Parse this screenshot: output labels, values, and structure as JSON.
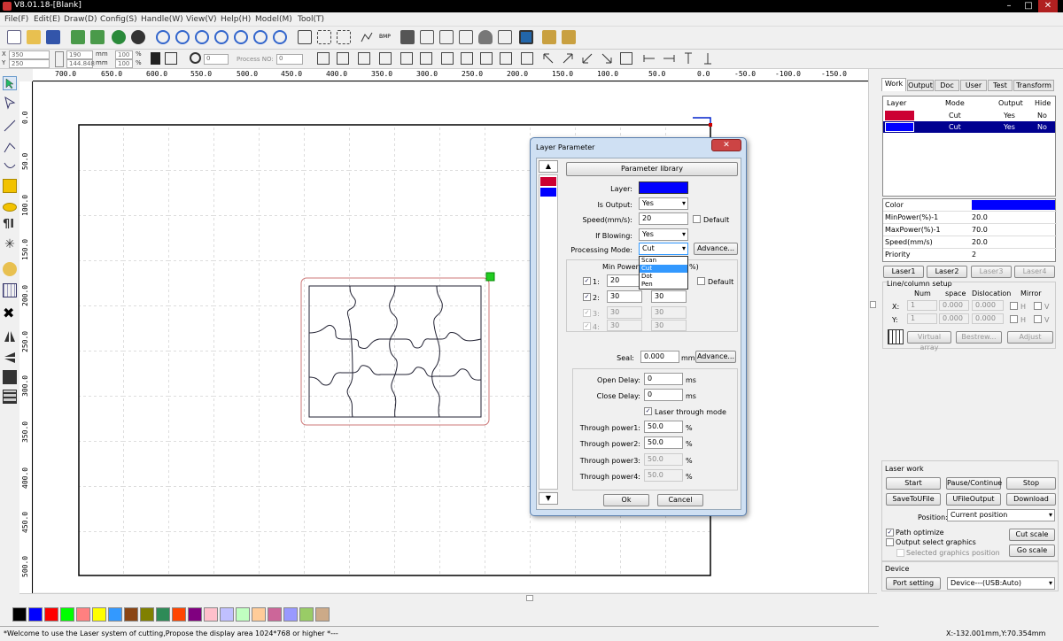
{
  "window": {
    "title": "V8.01.18-[Blank]",
    "min_icon": "minimize-icon",
    "max_icon": "maximize-icon",
    "close_icon": "close-icon"
  },
  "menu": [
    "File(F)",
    "Edit(E)",
    "Draw(D)",
    "Config(S)",
    "Handle(W)",
    "View(V)",
    "Help(H)",
    "Model(M)",
    "Tool(T)"
  ],
  "position_bar": {
    "x_label": "X",
    "x_value": "350",
    "y_label": "Y",
    "y_value": "250",
    "w_value": "190",
    "h_value": "144.848",
    "unit": "mm",
    "scale_x": "100",
    "scale_y": "100",
    "percent": "%",
    "rotate_value": "0",
    "process_no_label": "Process NO:",
    "process_no_value": "0"
  },
  "ruler_h": [
    "700.0",
    "650.0",
    "600.0",
    "550.0",
    "500.0",
    "450.0",
    "400.0",
    "350.0",
    "300.0",
    "250.0",
    "200.0",
    "150.0",
    "100.0",
    "50.0",
    "0.0",
    "-50.0",
    "-100.0",
    "-150.0"
  ],
  "ruler_v": [
    "0.0",
    "50.0",
    "100.0",
    "150.0",
    "200.0",
    "250.0",
    "300.0",
    "350.0",
    "400.0",
    "450.0",
    "500.0"
  ],
  "palette": [
    "#000000",
    "#0000ff",
    "#ff0000",
    "#00ff00",
    "#ff8080",
    "#ffff00",
    "#3399ff",
    "#8b4513",
    "#808000",
    "#2e8b57",
    "#ff4500",
    "#800080",
    "#ffc0cb",
    "#c0c0ff",
    "#c0ffc0",
    "#ffcc99",
    "#cc6699",
    "#9999ff",
    "#99cc66",
    "#ccaa88"
  ],
  "status": {
    "message": "*Welcome to use the Laser system of cutting,Propose the display area 1024*768 or higher *---",
    "coords": "X:-132.001mm,Y:70.354mm"
  },
  "right_panel": {
    "tabs": [
      "Work",
      "Output",
      "Doc",
      "User",
      "Test",
      "Transform"
    ],
    "layer_table": {
      "headers": [
        "Layer",
        "Mode",
        "Output",
        "Hide"
      ],
      "rows": [
        {
          "color": "#cc0033",
          "mode": "Cut",
          "output": "Yes",
          "hide": "No"
        },
        {
          "color": "#0000ff",
          "mode": "Cut",
          "output": "Yes",
          "hide": "No"
        }
      ]
    },
    "props": [
      {
        "label": "Color",
        "value": "",
        "color": "#0000ff"
      },
      {
        "label": "MinPower(%)-1",
        "value": "20.0"
      },
      {
        "label": "MaxPower(%)-1",
        "value": "70.0"
      },
      {
        "label": "Speed(mm/s)",
        "value": "20.0"
      },
      {
        "label": "Priority",
        "value": "2"
      }
    ],
    "laser_tabs": [
      "Laser1",
      "Laser2",
      "Laser3",
      "Laser4"
    ],
    "array": {
      "title": "Line/column setup",
      "headers": [
        "Num",
        "space",
        "Dislocation",
        "Mirror"
      ],
      "x_label": "X:",
      "y_label": "Y:",
      "x_num": "1",
      "x_space": "0.000",
      "x_disl": "0.000",
      "y_num": "1",
      "y_space": "0.000",
      "y_disl": "0.000",
      "h": "H",
      "v": "V",
      "virtual": "Virtual array",
      "bestrew": "Bestrew...",
      "adjust": "Adjust"
    },
    "laser_work": {
      "title": "Laser work",
      "start": "Start",
      "pause": "Pause/Continue",
      "stop": "Stop",
      "save": "SaveToUFile",
      "ufile": "UFileOutput",
      "download": "Download",
      "position_label": "Position:",
      "position_value": "Current position",
      "path_opt": "Path optimize",
      "output_sel": "Output select graphics",
      "sel_pos": "Selected graphics position",
      "cut_scale": "Cut scale",
      "go_scale": "Go scale"
    },
    "device": {
      "title": "Device",
      "port": "Port setting",
      "value": "Device---(USB:Auto)"
    }
  },
  "dialog": {
    "title": "Layer Parameter",
    "param_lib": "Parameter library",
    "layer_label": "Layer:",
    "layer_color": "#0000ff",
    "is_output_label": "Is Output:",
    "is_output": "Yes",
    "speed_label": "Speed(mm/s):",
    "speed": "20",
    "default_label": "Default",
    "blowing_label": "If Blowing:",
    "blowing": "Yes",
    "mode_label": "Processing Mode:",
    "mode": "Cut",
    "advance": "Advance...",
    "mode_options": [
      "Scan",
      "Cut",
      "Dot",
      "Pen"
    ],
    "power_header_min": "Min Power(",
    "power_header_max": "%)",
    "powers": [
      {
        "n": "1:",
        "min": "20",
        "max": "",
        "enabled": true
      },
      {
        "n": "2:",
        "min": "30",
        "max": "30",
        "enabled": true
      },
      {
        "n": "3:",
        "min": "30",
        "max": "30",
        "enabled": false
      },
      {
        "n": "4:",
        "min": "30",
        "max": "30",
        "enabled": false
      }
    ],
    "seal_label": "Seal:",
    "seal": "0.000",
    "mm": "mm",
    "open_delay_label": "Open Delay:",
    "open_delay": "0",
    "close_delay_label": "Close Delay:",
    "close_delay": "0",
    "ms": "ms",
    "through_mode": "Laser through mode",
    "through": [
      {
        "label": "Through power1:",
        "value": "50.0",
        "enabled": true
      },
      {
        "label": "Through power2:",
        "value": "50.0",
        "enabled": true
      },
      {
        "label": "Through power3:",
        "value": "50.0",
        "enabled": false
      },
      {
        "label": "Through power4:",
        "value": "50.0",
        "enabled": false
      }
    ],
    "percent": "%",
    "ok": "Ok",
    "cancel": "Cancel"
  }
}
